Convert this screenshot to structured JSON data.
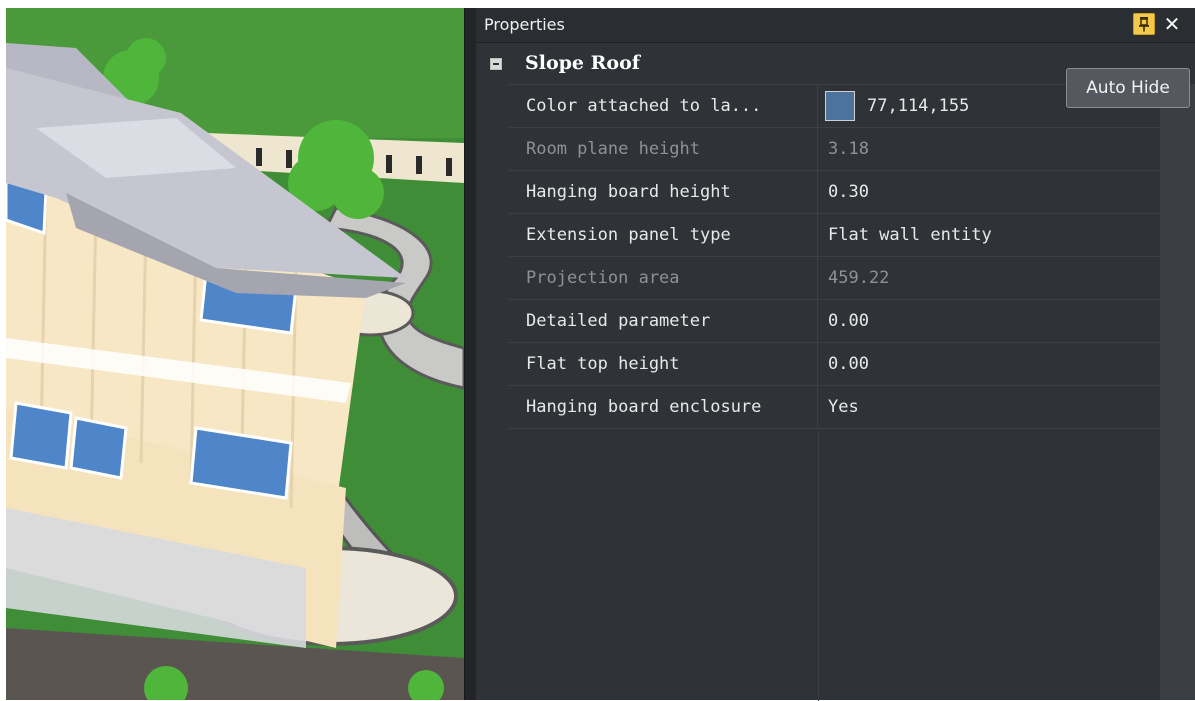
{
  "panel": {
    "title": "Properties",
    "close_glyph": "✕",
    "pin_icon": "pin-icon",
    "category": "Slope Roof",
    "collapse_icon": "collapse-minus-icon"
  },
  "properties": [
    {
      "name": "Color attached to la...",
      "value": "77,114,155",
      "swatch": "#4d729b",
      "disabled": false
    },
    {
      "name": "Room plane height",
      "value": "3.18",
      "disabled": true
    },
    {
      "name": "Hanging board height",
      "value": "0.30",
      "disabled": false
    },
    {
      "name": "Extension panel type",
      "value": "Flat wall entity",
      "disabled": false
    },
    {
      "name": "Projection area",
      "value": "459.22",
      "disabled": true
    },
    {
      "name": "Detailed parameter",
      "value": "0.00",
      "disabled": false
    },
    {
      "name": "Flat top height",
      "value": "0.00",
      "disabled": false
    },
    {
      "name": "Hanging board enclosure",
      "value": "Yes",
      "disabled": false
    }
  ],
  "tooltip": "Auto Hide",
  "colors": {
    "panel_bg": "#2f3236",
    "pin_active": "#f3c94a",
    "roof_color": "#4d729b"
  }
}
